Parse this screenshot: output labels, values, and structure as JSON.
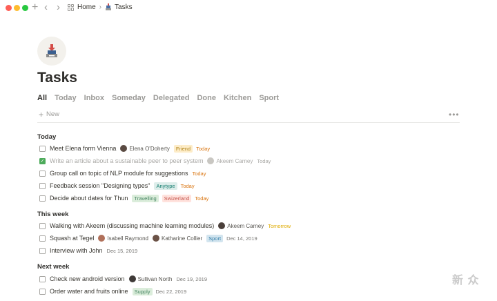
{
  "titlebar": {
    "nav_plus": "+",
    "nav_back": "‹",
    "nav_forward": "›",
    "breadcrumb": [
      {
        "label": "Home",
        "icon": "grid-icon"
      },
      {
        "label": "Tasks",
        "icon": "task-emoji-icon"
      }
    ],
    "separator": "›"
  },
  "page": {
    "title": "Tasks",
    "icon": "inbox-tray-icon"
  },
  "tabs": [
    {
      "label": "All",
      "active": true
    },
    {
      "label": "Today",
      "active": false
    },
    {
      "label": "Inbox",
      "active": false
    },
    {
      "label": "Someday",
      "active": false
    },
    {
      "label": "Delegated",
      "active": false
    },
    {
      "label": "Done",
      "active": false
    },
    {
      "label": "Kitchen",
      "active": false
    },
    {
      "label": "Sport",
      "active": false
    }
  ],
  "toolbar": {
    "new_label": "New",
    "more_label": "•••"
  },
  "groups": {
    "today": {
      "title": "Today",
      "tasks": [
        {
          "text": "Meet Elena form Vienna",
          "person": "Elena O'Doherty",
          "tag": "Friend",
          "tag_color": "#fdecc8",
          "tag_text": "#b0851c",
          "date": "Today",
          "date_color": "#d9730d",
          "done": false
        },
        {
          "text": "Write an article about a sustainable peer to peer system",
          "person": "Akeem Carney",
          "date": "Today",
          "date_color": "#a9a8a5",
          "done": true
        },
        {
          "text": "Group call on topic of NLP module for suggestions",
          "date": "Today",
          "date_color": "#d9730d",
          "done": false
        },
        {
          "text": "Feedback session \"Designing types\"",
          "tag": "Anytype",
          "tag_color": "#ddedea",
          "tag_text": "#0f7b6c",
          "date": "Today",
          "date_color": "#d9730d",
          "done": false
        },
        {
          "text": "Decide about dates for Thun",
          "tag": "Travelling",
          "tag_color": "#dbeddb",
          "tag_text": "#448361",
          "tag2": "Swizerland",
          "tag2_color": "#ffe2dd",
          "tag2_text": "#c4554d",
          "date": "Today",
          "date_color": "#d9730d",
          "done": false
        }
      ]
    },
    "this_week": {
      "title": "This week",
      "tasks": [
        {
          "text": "Walking with Akeem (discussing machine learning modules)",
          "person": "Akeem Carney",
          "date": "Tomorrow",
          "date_color": "#dfab01",
          "done": false
        },
        {
          "text": "Squash at Tegel",
          "person": "Isabell Raymond",
          "person2": "Katharine Collier",
          "tag": "Sport",
          "tag_color": "#d3e5ef",
          "tag_text": "#337ea9",
          "date": "Dec 14, 2019",
          "date_color": "#787774",
          "done": false
        },
        {
          "text": "Interview with John",
          "date": "Dec 15, 2019",
          "date_color": "#787774",
          "done": false
        }
      ]
    },
    "next_week": {
      "title": "Next week",
      "tasks": [
        {
          "text": "Check new android version",
          "person": "Sullivan North",
          "date": "Dec 19, 2019",
          "date_color": "#787774",
          "done": false
        },
        {
          "text": "Order water and fruits online",
          "tag": "Supply",
          "tag_color": "#dbeddb",
          "tag_text": "#448361",
          "date": "Dec 22, 2019",
          "date_color": "#787774",
          "done": false
        }
      ]
    }
  },
  "watermark": "新 众"
}
